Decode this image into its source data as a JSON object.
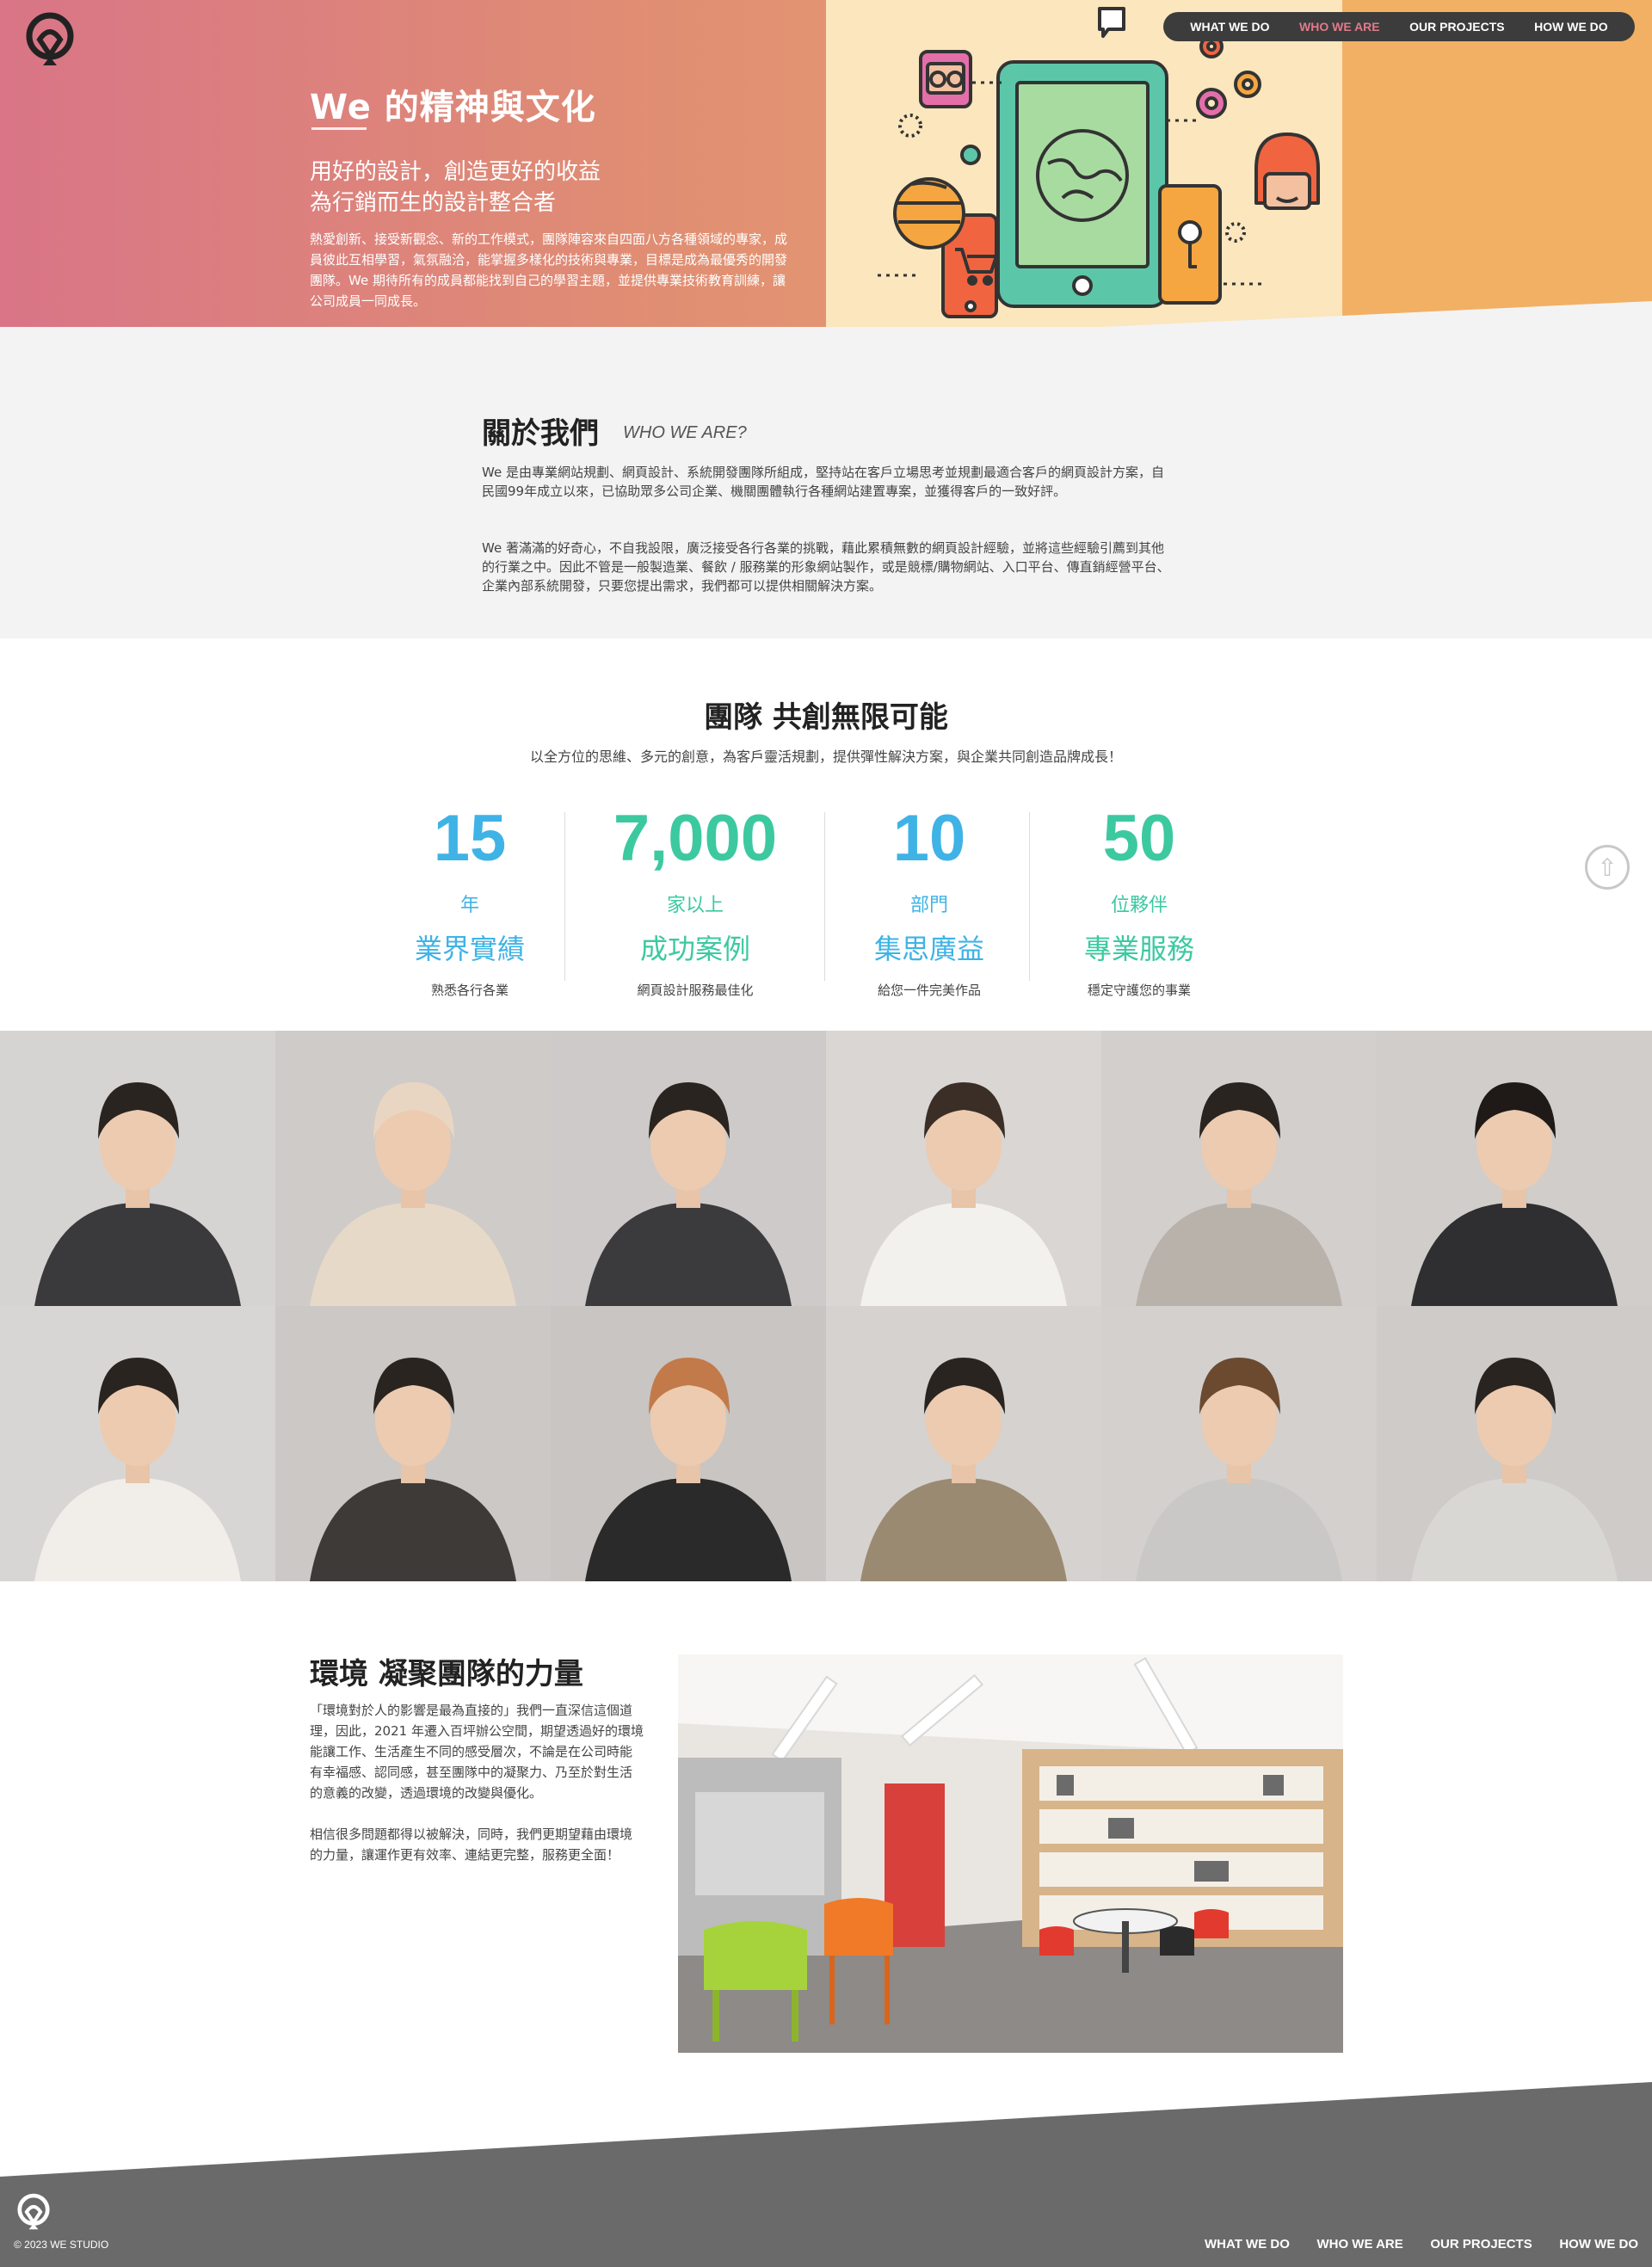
{
  "nav": {
    "items": [
      {
        "label": "WHAT WE DO",
        "active": false
      },
      {
        "label": "WHO WE ARE",
        "active": true
      },
      {
        "label": "OUR PROJECTS",
        "active": false
      },
      {
        "label": "HOW WE DO",
        "active": false
      }
    ],
    "active_color": "#e07a8a"
  },
  "hero": {
    "title": "We 的精神與文化",
    "subtitle_1": "用好的設計，創造更好的收益",
    "subtitle_2": "為行銷而生的設計整合者",
    "body": "熱愛創新、接受新觀念、新的工作模式，團隊陣容來自四面八方各種領域的專家，成員彼此互相學習，氣氛融洽，能掌握多樣化的技術與專業，目標是成為最優秀的開發團隊。We 期待所有的成員都能找到自己的學習主題，並提供專業技術教育訓練，讓公司成員一同成長。",
    "gradient_colors": [
      "#d97587",
      "#e08e73",
      "#f0b36a"
    ]
  },
  "about": {
    "title": "關於我們",
    "title_en": "WHO WE ARE?",
    "paragraph_1": "We 是由專業網站規劃、網頁設計、系統開發團隊所組成，堅持站在客戶立場思考並規劃最適合客戶的網頁設計方案，自民國99年成立以來，已協助眾多公司企業、機關團體執行各種網站建置專案，並獲得客戶的一致好評。",
    "paragraph_2": "We 著滿滿的好奇心，不自我設限，廣泛接受各行各業的挑戰，藉此累積無數的網頁設計經驗，並將這些經驗引薦到其他的行業之中。因此不管是一般製造業、餐飲 / 服務業的形象網站製作，或是競標/購物網站、入口平台、傳直銷經營平台、企業內部系統開發，只要您提出需求，我們都可以提供相關解決方案。"
  },
  "team": {
    "title": "團隊 共創無限可能",
    "subtitle": "以全方位的思維、多元的創意，為客戶靈活規劃，提供彈性解決方案，與企業共同創造品牌成長！",
    "stats": [
      {
        "number": "15",
        "unit": "年",
        "name": "業界實績",
        "desc": "熟悉各行各業",
        "color": "#3fb3e6"
      },
      {
        "number": "7,000",
        "unit": "家以上",
        "name": "成功案例",
        "desc": "網頁設計服務最佳化",
        "color": "#3cc9a0"
      },
      {
        "number": "10",
        "unit": "部門",
        "name": "集思廣益",
        "desc": "給您一件完美作品",
        "color": "#3fb3e6"
      },
      {
        "number": "50",
        "unit": "位夥伴",
        "name": "專業服務",
        "desc": "穩定守護您的事業",
        "color": "#3cc9a0"
      }
    ]
  },
  "environment": {
    "title": "環境 凝聚團隊的力量",
    "paragraph_1": "「環境對於人的影響是最為直接的」我們一直深信這個道理，因此，2021 年遷入百坪辦公空間，期望透過好的環境能讓工作、生活產生不同的感受層次，不論是在公司時能有幸福感、認同感，甚至團隊中的凝聚力、乃至於對生活的意義的改變，透過環境的改變與優化。",
    "paragraph_2": "相信很多問題都得以被解決，同時，我們更期望藉由環境的力量，讓運作更有效率、連結更完整，服務更全面！"
  },
  "footer": {
    "copyright": "© 2023 WE STUDIO",
    "nav": [
      "WHAT WE DO",
      "WHO WE ARE",
      "OUR PROJECTS",
      "HOW WE DO"
    ],
    "bg_color": "#6a6a6a"
  }
}
